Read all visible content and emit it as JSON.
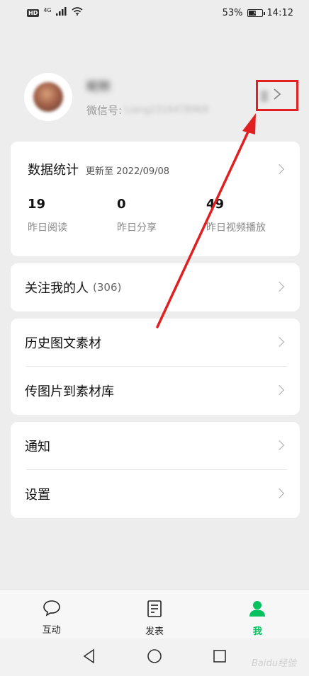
{
  "status_bar": {
    "hd": "HD",
    "network": "4G",
    "battery_percent": "53%",
    "time": "14:12"
  },
  "profile": {
    "nickname": "昵称",
    "wechat_label": "微信号:",
    "wechat_id": "Liang2316478968"
  },
  "stats": {
    "title": "数据统计",
    "updated": "更新至 2022/09/08",
    "items": [
      {
        "value": "19",
        "label": "昨日阅读"
      },
      {
        "value": "0",
        "label": "昨日分享"
      },
      {
        "value": "49",
        "label": "昨日视频播放"
      }
    ]
  },
  "followers": {
    "label": "关注我的人",
    "count": "(306)"
  },
  "materials": {
    "history_label": "历史图文素材",
    "upload_label": "传图片到素材库"
  },
  "settings_group": {
    "notify_label": "通知",
    "settings_label": "设置"
  },
  "tabs": [
    {
      "label": "互动",
      "icon": "chat-bubble-icon"
    },
    {
      "label": "发表",
      "icon": "document-icon"
    },
    {
      "label": "我",
      "icon": "person-icon"
    }
  ],
  "watermark": "Baidu经验",
  "colors": {
    "accent": "#07c160",
    "annotation_red": "#e02020",
    "background": "#ededed"
  }
}
